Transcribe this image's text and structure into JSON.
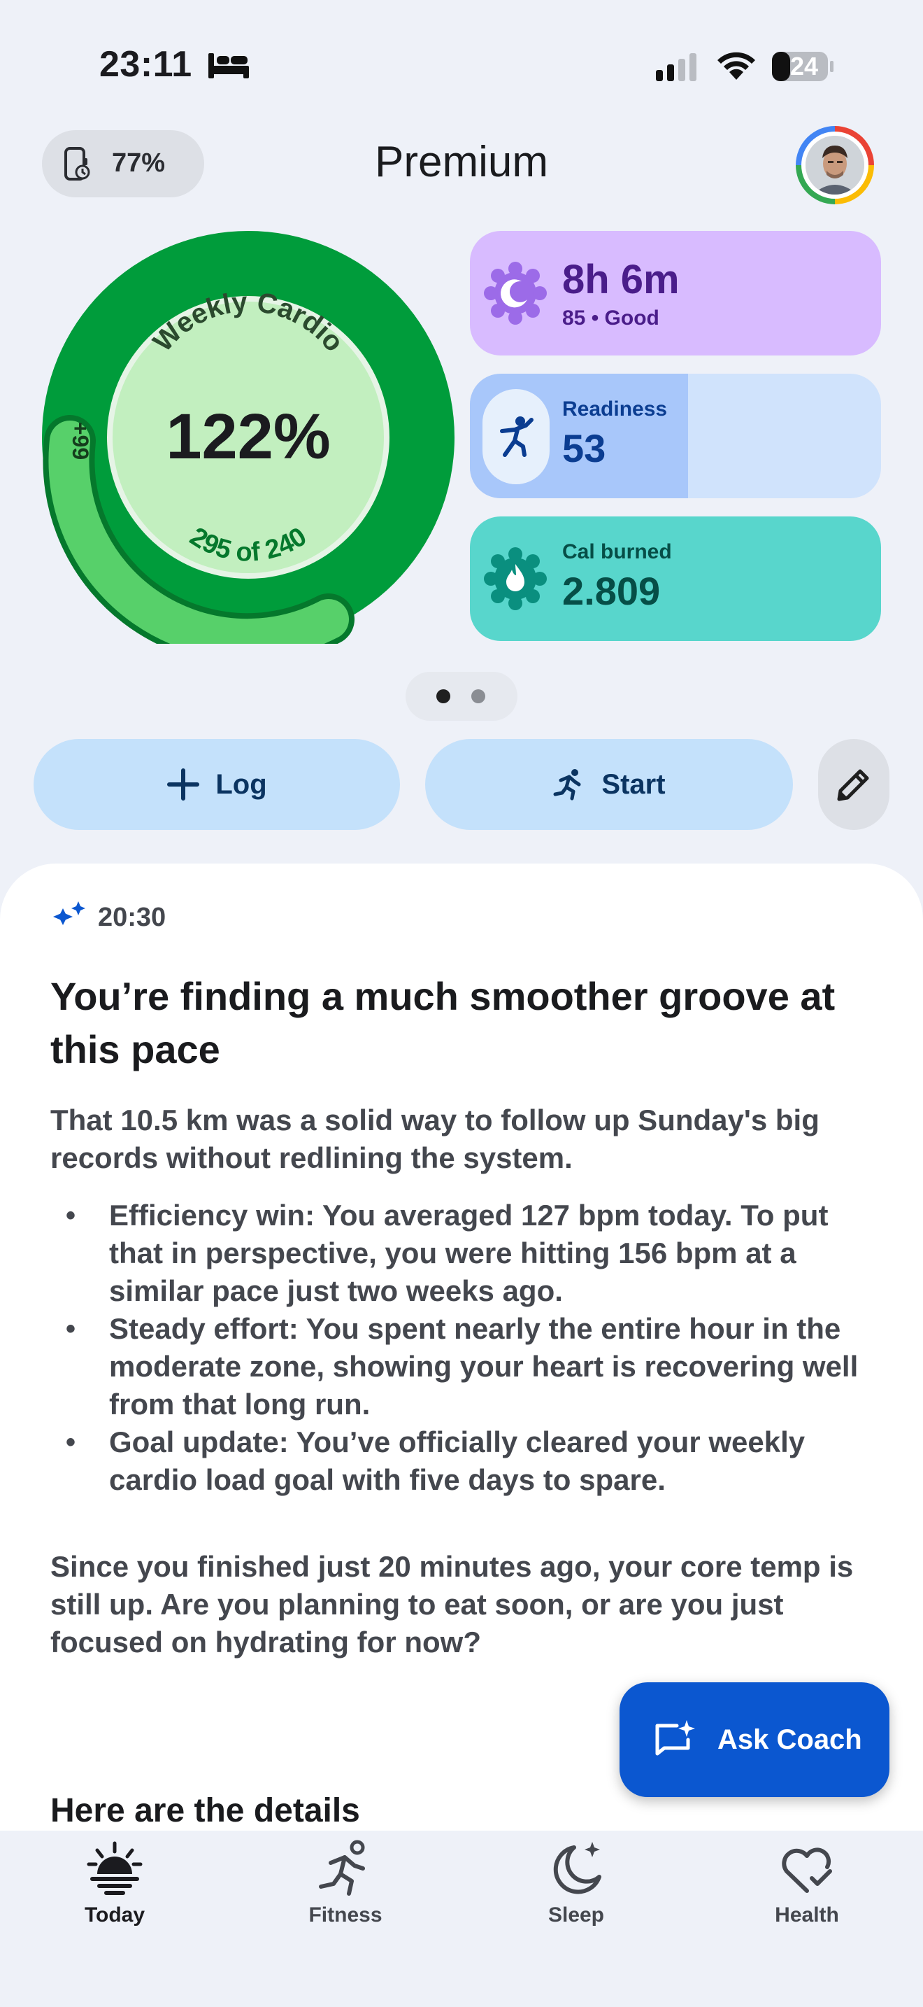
{
  "status_bar": {
    "time": "23:11",
    "battery": "24"
  },
  "header": {
    "watch_battery": "77%",
    "title": "Premium"
  },
  "ring": {
    "label": "Weekly Cardio",
    "percent": "122%",
    "progress_text": "295 of 240",
    "overflow": "+99"
  },
  "cards": {
    "sleep": {
      "value": "8h 6m",
      "sub": "85 • Good"
    },
    "readiness": {
      "label": "Readiness",
      "value": "53",
      "level_fraction": 0.53
    },
    "calories": {
      "label": "Cal burned",
      "value": "2.809"
    }
  },
  "actions": {
    "log_label": "Log",
    "start_label": "Start"
  },
  "insight": {
    "time": "20:30",
    "headline": "You’re finding a much smoother groove at this pace",
    "intro": "That 10.5 km was a solid way to follow up Sunday's big records without redlining the system.",
    "bullets": [
      "Efficiency win: You averaged 127 bpm today. To put that in perspective, you were hitting 156 bpm at a similar pace just two weeks ago.",
      "Steady effort: You spent nearly the entire hour in the moderate zone, showing your heart is recovering well from that long run.",
      "Goal update: You’ve officially cleared your weekly cardio load goal with five days to spare."
    ],
    "followup": "Since you finished just 20 minutes ago, your core temp is still up. Are you planning to eat soon, or are you just focused on hydrating for now?",
    "details_heading": "Here are the details"
  },
  "fab": {
    "label": "Ask Coach"
  },
  "nav": {
    "today": "Today",
    "fitness": "Fitness",
    "sleep": "Sleep",
    "health": "Health"
  },
  "colors": {
    "ring_dark": "#009c3b",
    "ring_light": "#c2efbf",
    "accent": "#0b57d0",
    "sleep_card": "#d8bbff",
    "cal_card": "#58d6cc"
  }
}
